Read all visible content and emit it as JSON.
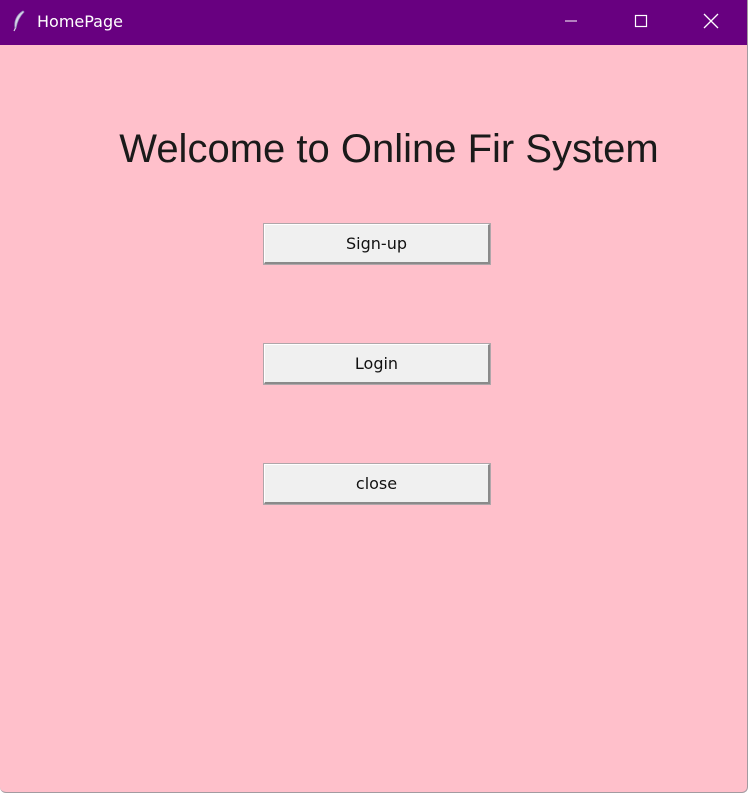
{
  "window": {
    "title": "HomePage",
    "app_icon": "feather-icon",
    "titlebar_color": "#680080",
    "background_color": "#ffc0cb",
    "controls": {
      "minimize": "minimize-icon",
      "maximize": "maximize-icon",
      "close": "close-icon"
    }
  },
  "main": {
    "heading": "Welcome to Online Fir System",
    "buttons": {
      "signup": "Sign-up",
      "login": "Login",
      "close": "close"
    }
  }
}
